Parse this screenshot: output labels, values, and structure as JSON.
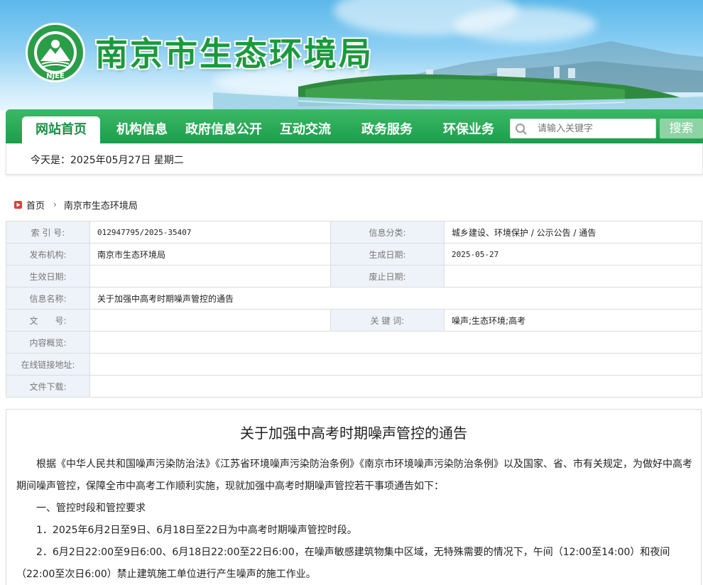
{
  "site": {
    "title": "南京市生态环境局",
    "logo_text": "NJEE"
  },
  "nav": {
    "items": [
      {
        "label": "网站首页",
        "active": true
      },
      {
        "label": "机构信息",
        "active": false
      },
      {
        "label": "政府信息公开",
        "active": false
      },
      {
        "label": "互动交流",
        "active": false
      },
      {
        "label": "政务服务",
        "active": false
      },
      {
        "label": "环保业务",
        "active": false
      }
    ],
    "search_placeholder": "请输入关键字",
    "search_button": "搜索"
  },
  "date_bar": {
    "text": "今天是：2025年05月27日 星期二"
  },
  "breadcrumb": {
    "home": "首页",
    "current": "南京市生态环境局"
  },
  "info": {
    "index_label": "索 引 号:",
    "index_value": "012947795/2025-35407",
    "category_label": "信息分类:",
    "category_value": "城乡建设、环境保护 / 公示公告 / 通告",
    "publisher_label": "发布机构:",
    "publisher_value": "南京市生态环境局",
    "created_label": "生成日期:",
    "created_value": "2025-05-27",
    "effective_label": "生效日期:",
    "effective_value": "",
    "abolished_label": "废止日期:",
    "abolished_value": "",
    "name_label": "信息名称:",
    "name_value": "关于加强中高考时期噪声管控的通告",
    "doc_label": "文　　号:",
    "doc_value": "",
    "keywords_label": "关 键 词:",
    "keywords_value": "噪声;生态环境;高考",
    "summary_label": "内容概览:",
    "summary_value": "",
    "link_label": "在线链接地址:",
    "link_value": "",
    "download_label": "文件下载:",
    "download_value": ""
  },
  "article": {
    "title": "关于加强中高考时期噪声管控的通告",
    "p1": "根据《中华人民共和国噪声污染防治法》《江苏省环境噪声污染防治条例》《南京市环境噪声污染防治条例》以及国家、省、市有关规定，为做好中高考期间噪声管控，保障全市中高考工作顺利实施，现就加强中高考时期噪声管控若干事项通告如下：",
    "h1": "一、管控时段和管控要求",
    "p2": "1．2025年6月2日至9日、6月18日至22日为中高考时期噪声管控时段。",
    "p3": "2．6月2日22:00至9日6:00、6月18日22:00至22日6:00，在噪声敏感建筑物集中区域，无特殊需要的情况下，午间（12:00至14:00）和夜间（22:00至次日6:00）禁止建筑施工单位进行产生噪声的施工作业。"
  },
  "colors": {
    "nav_green": "#1b9e4c",
    "title_green": "#1a9a3c",
    "label_bg": "#eef3f9"
  }
}
